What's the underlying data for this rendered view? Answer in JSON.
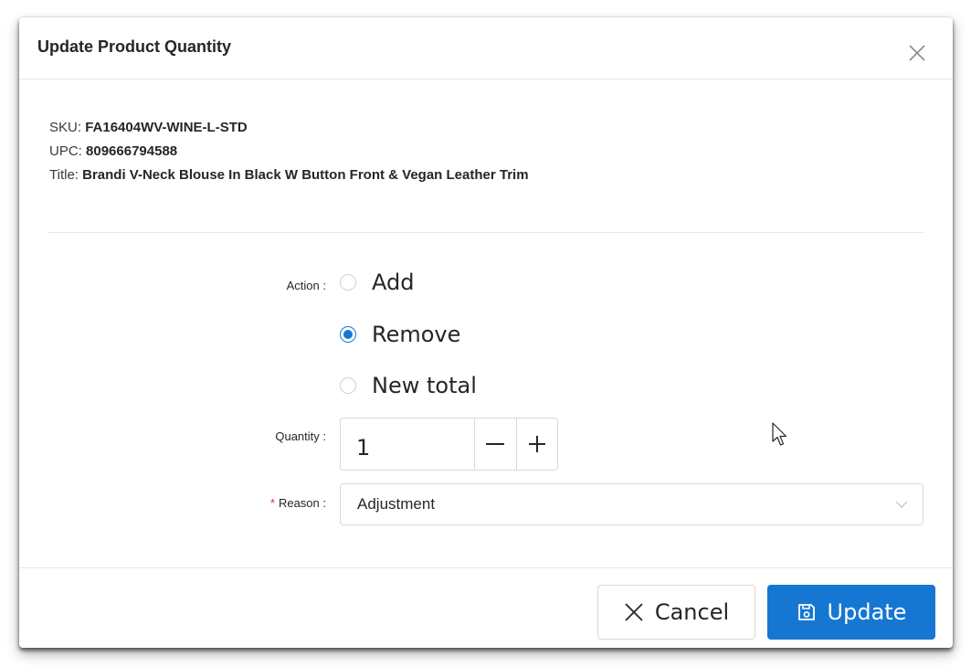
{
  "modal": {
    "title": "Update Product Quantity"
  },
  "product": {
    "sku_label": "SKU: ",
    "sku": "FA16404WV-WINE-L-STD",
    "upc_label": "UPC: ",
    "upc": "809666794588",
    "title_label": "Title: ",
    "title": "Brandi V-Neck Blouse In Black W Button Front & Vegan Leather Trim"
  },
  "form": {
    "action_label": "Action :",
    "action_options": [
      {
        "label": "Add",
        "checked": false
      },
      {
        "label": "Remove",
        "checked": true
      },
      {
        "label": "New total",
        "checked": false
      }
    ],
    "quantity_label": "Quantity :",
    "quantity_value": "1",
    "reason_required_mark": "*",
    "reason_label": "Reason :",
    "reason_value": "Adjustment"
  },
  "footer": {
    "cancel_label": "Cancel",
    "update_label": "Update"
  },
  "icons": {
    "close": "close-icon",
    "minus": "minus-icon",
    "plus": "plus-icon",
    "dropdown": "chevron-down-icon",
    "cancel": "close-icon",
    "save": "save-icon",
    "cursor": "mouse-pointer-icon"
  },
  "colors": {
    "primary": "#1677d2",
    "required": "#f5222d",
    "border": "#d9d9d9",
    "text": "#262626"
  }
}
